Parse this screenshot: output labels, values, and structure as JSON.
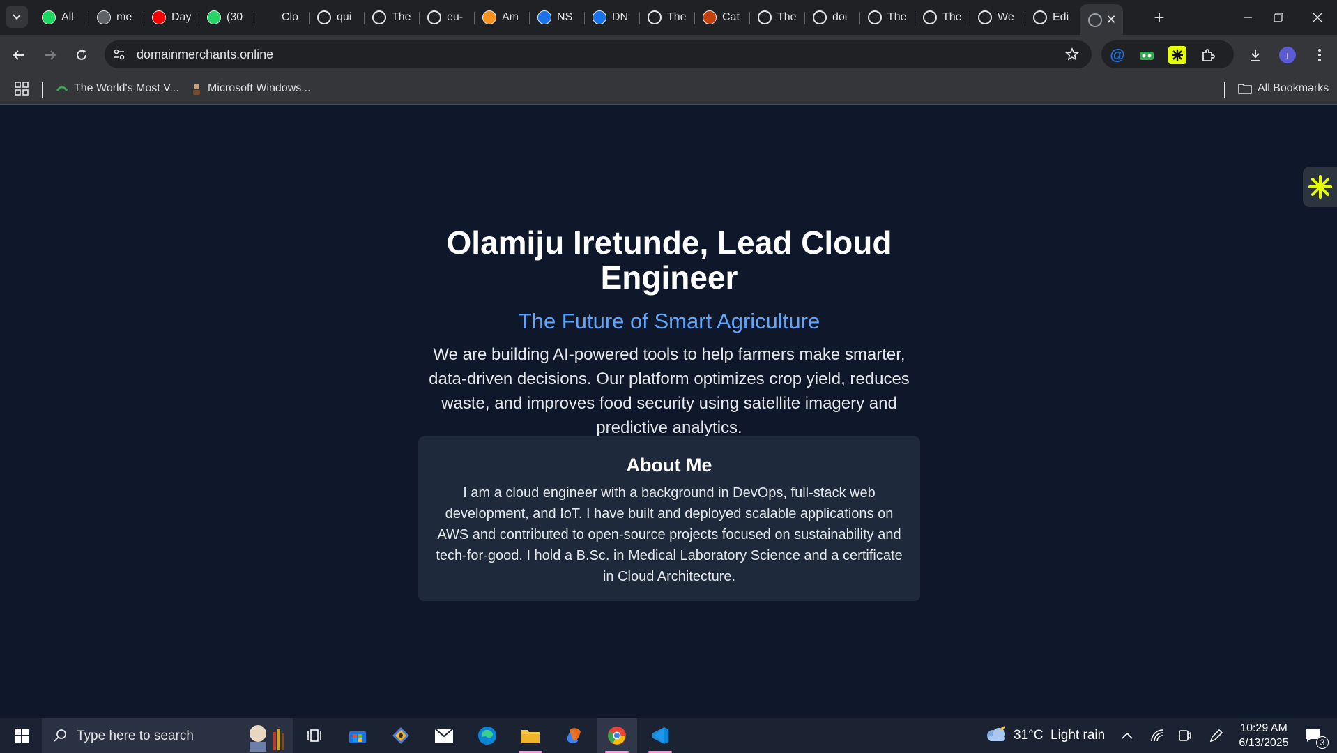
{
  "browser": {
    "tabs": [
      {
        "title": "All",
        "icon": "refresh-green-icon",
        "color": "#1ed760"
      },
      {
        "title": "me",
        "icon": "avatar-icon",
        "color": "#5f6368"
      },
      {
        "title": "Day",
        "icon": "youtube-icon",
        "color": "#ff0000"
      },
      {
        "title": "(30",
        "icon": "whatsapp-icon",
        "color": "#25d366"
      },
      {
        "title": "Clo",
        "icon": "blank-icon",
        "color": "transparent"
      },
      {
        "title": "qui",
        "icon": "openai-icon",
        "color": "#202124"
      },
      {
        "title": "The",
        "icon": "globe-icon",
        "color": "#202124"
      },
      {
        "title": "eu-",
        "icon": "globe-icon",
        "color": "#202124"
      },
      {
        "title": "Am",
        "icon": "aws-cube-icon",
        "color": "#f7931e"
      },
      {
        "title": "NS",
        "icon": "shield-icon",
        "color": "#1a73e8"
      },
      {
        "title": "DN",
        "icon": "shield-icon",
        "color": "#1a73e8"
      },
      {
        "title": "The",
        "icon": "globe-icon",
        "color": "#202124"
      },
      {
        "title": "Cat",
        "icon": "claude-icon",
        "color": "#c2410c"
      },
      {
        "title": "The",
        "icon": "globe-icon",
        "color": "#202124"
      },
      {
        "title": "doi",
        "icon": "globe-icon",
        "color": "#202124"
      },
      {
        "title": "The",
        "icon": "globe-icon",
        "color": "#202124"
      },
      {
        "title": "The",
        "icon": "globe-icon",
        "color": "#202124"
      },
      {
        "title": "We",
        "icon": "openai-icon",
        "color": "#202124"
      },
      {
        "title": "Edi",
        "icon": "github-icon",
        "color": "#202124"
      }
    ],
    "url": "domainmerchants.online",
    "bookmarks": [
      {
        "label": "The World's Most V...",
        "icon": "bookmark-favicon-icon"
      },
      {
        "label": "Microsoft Windows...",
        "icon": "person-favicon-icon"
      }
    ],
    "all_bookmarks_label": "All Bookmarks",
    "profile_initial": "i",
    "colors": {
      "frame": "#202124",
      "toolbar": "#35363a",
      "accent_profile": "#5b5bd6"
    }
  },
  "page": {
    "title": "Olamiju Iretunde, Lead Cloud Engineer",
    "subtitle": "The Future of Smart Agriculture",
    "description": "We are building AI-powered tools to help farmers make smarter, data-driven decisions. Our platform optimizes crop yield, reduces waste, and improves food security using satellite imagery and predictive analytics.",
    "about": {
      "heading": "About Me",
      "text": "I am a cloud engineer with a background in DevOps, full-stack web development, and IoT. I have built and deployed scalable applications on AWS and contributed to open-source projects focused on sustainability and tech-for-good. I hold a B.Sc. in Medical Laboratory Science and a certificate in Cloud Architecture."
    },
    "colors": {
      "background": "#0f172a",
      "card": "#1e293b",
      "subtitle": "#60a5fa"
    }
  },
  "taskbar": {
    "search_placeholder": "Type here to search",
    "weather": "31°C  Light rain",
    "time": "10:29 AM",
    "date": "6/13/2025",
    "notification_count": "3"
  }
}
